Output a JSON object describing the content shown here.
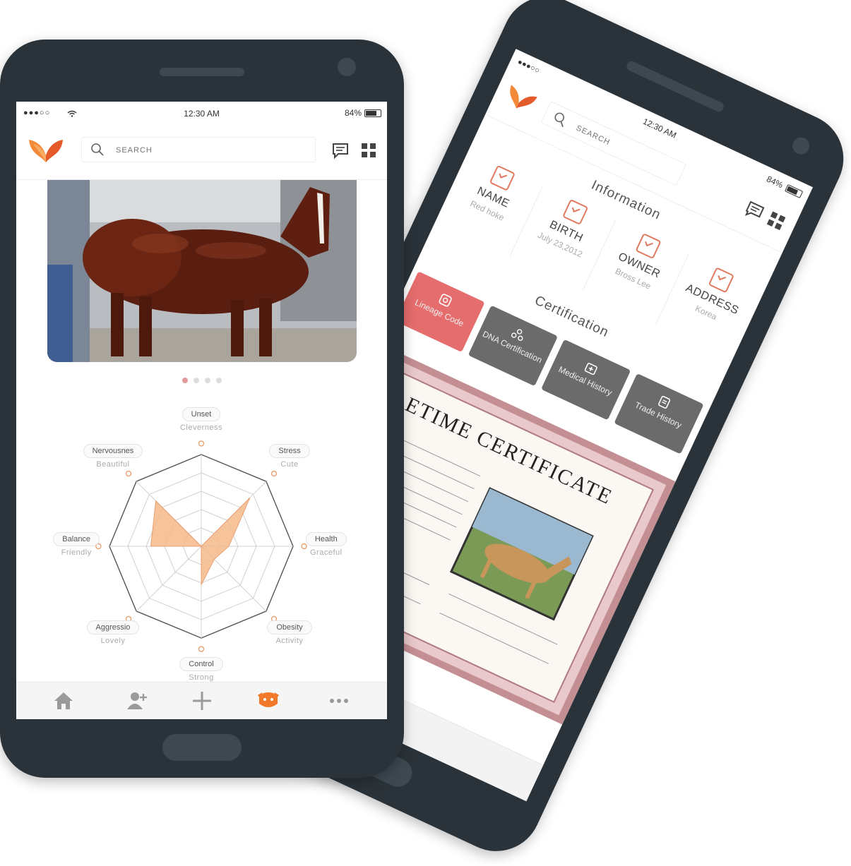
{
  "front": {
    "status": {
      "signal": "●●●○○",
      "time": "12:30 AM",
      "battery": "84%"
    },
    "search": {
      "placeholder": "SEARCH"
    },
    "icons": {
      "logo": "butterfly-logo",
      "chat": "chat-icon",
      "grid": "grid-icon"
    },
    "carousel": {
      "pages": 4,
      "active": 0
    },
    "radar": {
      "axes": [
        {
          "label": "Unset",
          "sub": "Cleverness",
          "value": 0.0
        },
        {
          "label": "Stress",
          "sub": "Cute",
          "value": 0.75
        },
        {
          "label": "Health",
          "sub": "Graceful",
          "value": 0.3
        },
        {
          "label": "Obesity",
          "sub": "Activity",
          "value": 0.2
        },
        {
          "label": "Control",
          "sub": "Strong",
          "value": 0.42
        },
        {
          "label": "Aggressio",
          "sub": "Lovely",
          "value": 0.0
        },
        {
          "label": "Balance",
          "sub": "Friendly",
          "value": 0.55
        },
        {
          "label": "Nervousnes",
          "sub": "Beautiful",
          "value": 0.7
        }
      ],
      "fill_color": "#f5b98a",
      "levels": 5
    },
    "nav": [
      "home-icon",
      "add-user-icon",
      "plus-icon",
      "horse-icon",
      "more-icon"
    ],
    "accent": "#f07a2a"
  },
  "back": {
    "status": {
      "signal": "●●●○○",
      "time": "12:30 AM",
      "battery": "84%"
    },
    "search": {
      "placeholder": "SEARCH"
    },
    "info_title": "Information",
    "info": [
      {
        "label": "NAME",
        "value": "Red hoke"
      },
      {
        "label": "BIRTH",
        "value": "July 23,2012"
      },
      {
        "label": "OWNER",
        "value": "Bross Lee"
      },
      {
        "label": "ADDRESS",
        "value": "Korea"
      }
    ],
    "cert_title": "Certification",
    "cert_tabs": [
      {
        "label": "Lineage Code",
        "active": true
      },
      {
        "label": "DNA Certification",
        "active": false
      },
      {
        "label": "Medical History",
        "active": false
      },
      {
        "label": "Trade History",
        "active": false
      }
    ],
    "certificate": {
      "heading": "ETIME CERTIFICATE"
    },
    "colors": {
      "active_tab": "#e66d6d",
      "tab": "#6b6b6b",
      "check": "#e07a5f"
    }
  }
}
